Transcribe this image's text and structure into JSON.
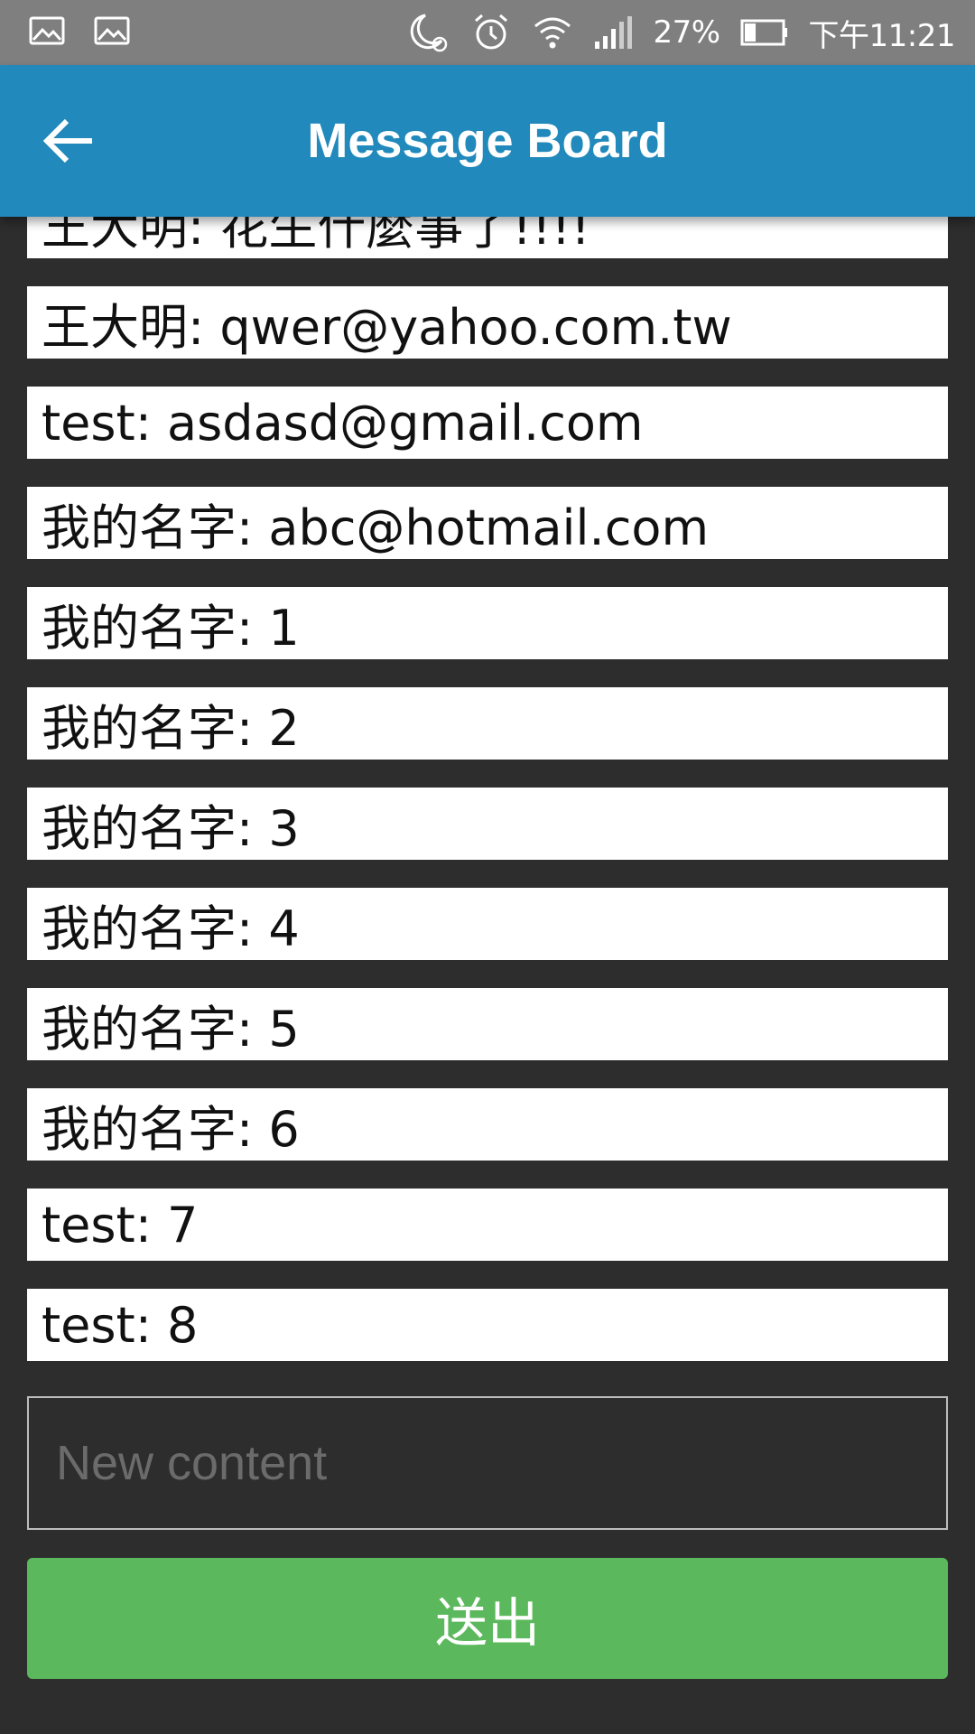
{
  "status_bar": {
    "battery_percent": "27%",
    "time": "下午11:21",
    "icons": [
      "image-icon",
      "image-icon",
      "moon-alarm-icon",
      "alarm-clock-icon",
      "wifi-icon",
      "signal-icon",
      "battery-icon"
    ]
  },
  "app_bar": {
    "title": "Message Board",
    "back_icon": "arrow-left-icon",
    "color": "#2189bb"
  },
  "messages": [
    "王大明: 花生什麼事了!!!!",
    "王大明: qwer@yahoo.com.tw",
    "test: asdasd@gmail.com",
    "我的名字: abc@hotmail.com",
    "我的名字: 1",
    "我的名字: 2",
    "我的名字: 3",
    "我的名字: 4",
    "我的名字: 5",
    "我的名字: 6",
    "test: 7",
    "test: 8"
  ],
  "composer": {
    "placeholder": "New content",
    "value": "",
    "send_label": "送出",
    "send_color": "#5cb85c"
  }
}
